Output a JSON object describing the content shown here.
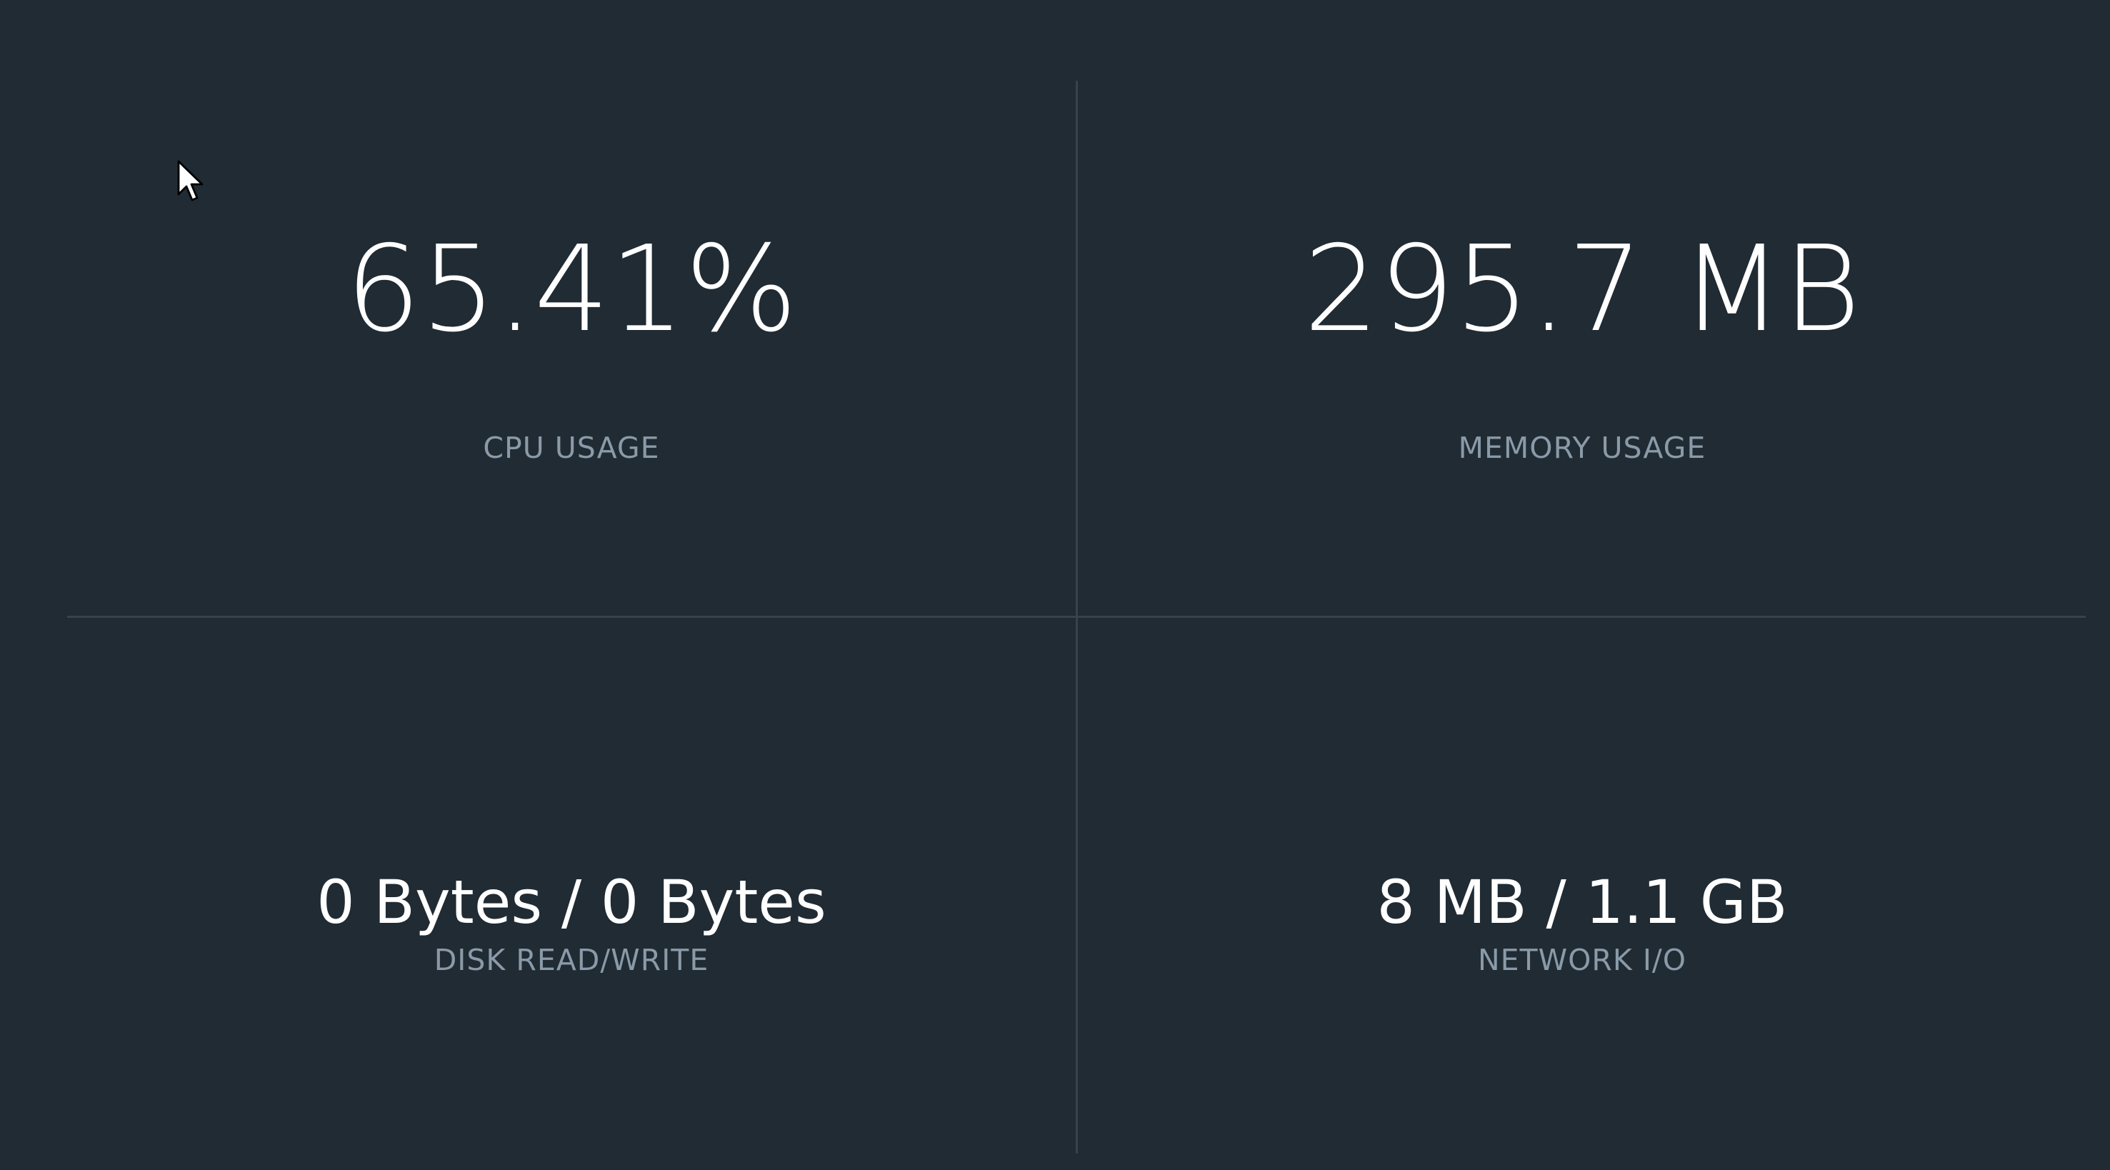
{
  "metrics": {
    "cpu": {
      "value": "65.41%",
      "label": "CPU USAGE"
    },
    "memory": {
      "value": "295.7 MB",
      "label": "MEMORY USAGE"
    },
    "disk": {
      "value": "0 Bytes / 0 Bytes",
      "label": "DISK READ/WRITE"
    },
    "network": {
      "value": "8 MB / 1.1 GB",
      "label": "NETWORK I/O"
    }
  },
  "colors": {
    "background": "#202b34",
    "value_text": "#ffffff",
    "label_text": "#8a9aa8",
    "divider": "#36434d"
  },
  "icons": {
    "cursor": "mouse-pointer-icon"
  }
}
